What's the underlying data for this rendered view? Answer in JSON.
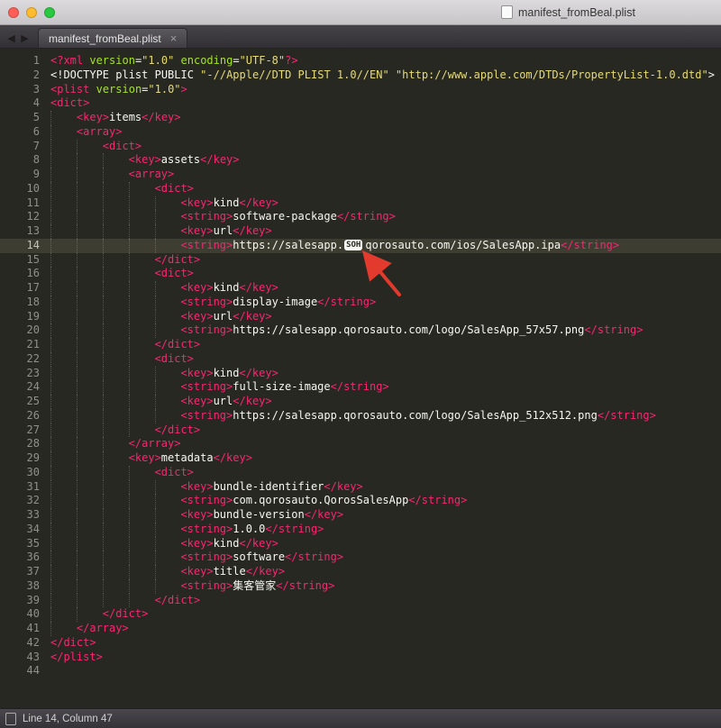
{
  "window": {
    "title": "manifest_fromBeal.plist"
  },
  "tab_bar": {
    "back_icon": "◀",
    "forward_icon": "▶",
    "tabs": [
      {
        "label": "manifest_fromBeal.plist",
        "close_icon": "×",
        "active": true
      }
    ]
  },
  "status_bar": {
    "text": "Line 14, Column 47"
  },
  "colors": {
    "editor_bg": "#272822",
    "text": "#f8f8f2",
    "tag": "#f92672",
    "string": "#e6db74",
    "attribute": "#a6e22e",
    "line_number": "#90908a",
    "current_line_bg": "#3e3d32",
    "control_char_bg": "#f8f8f2",
    "control_char_fg": "#272822",
    "annotation_arrow": "#e23b2e",
    "traffic_close": "#ff5f57",
    "traffic_minimize": "#febc2e",
    "traffic_zoom": "#28c840"
  },
  "editor": {
    "current_line": 14,
    "cursor": {
      "line": 14,
      "column": 47
    },
    "control_char_label": "SOH",
    "lines": [
      {
        "num": 1,
        "ind": 0,
        "segs": [
          [
            "p",
            "<?xml"
          ],
          [
            "w",
            " "
          ],
          [
            "g",
            "version"
          ],
          [
            "w",
            "="
          ],
          [
            "y",
            "\"1.0\""
          ],
          [
            "w",
            " "
          ],
          [
            "g",
            "encoding"
          ],
          [
            "w",
            "="
          ],
          [
            "y",
            "\"UTF-8\""
          ],
          [
            "p",
            "?>"
          ]
        ]
      },
      {
        "num": 2,
        "ind": 0,
        "segs": [
          [
            "w",
            "<!DOCTYPE plist PUBLIC "
          ],
          [
            "y",
            "\"-//Apple//DTD PLIST 1.0//EN\""
          ],
          [
            "w",
            " "
          ],
          [
            "y",
            "\"http://www.apple.com/DTDs/PropertyList-1.0.dtd\""
          ],
          [
            "w",
            ">"
          ]
        ]
      },
      {
        "num": 3,
        "ind": 0,
        "segs": [
          [
            "p",
            "<plist"
          ],
          [
            "w",
            " "
          ],
          [
            "g",
            "version"
          ],
          [
            "w",
            "="
          ],
          [
            "y",
            "\"1.0\""
          ],
          [
            "p",
            ">"
          ]
        ]
      },
      {
        "num": 4,
        "ind": 0,
        "segs": [
          [
            "p",
            "<dict>"
          ]
        ]
      },
      {
        "num": 5,
        "ind": 1,
        "segs": [
          [
            "p",
            "<key>"
          ],
          [
            "w",
            "items"
          ],
          [
            "p",
            "</key>"
          ]
        ]
      },
      {
        "num": 6,
        "ind": 1,
        "segs": [
          [
            "p",
            "<array>"
          ]
        ]
      },
      {
        "num": 7,
        "ind": 2,
        "segs": [
          [
            "p",
            "<dict>"
          ]
        ]
      },
      {
        "num": 8,
        "ind": 3,
        "segs": [
          [
            "p",
            "<key>"
          ],
          [
            "w",
            "assets"
          ],
          [
            "p",
            "</key>"
          ]
        ]
      },
      {
        "num": 9,
        "ind": 3,
        "segs": [
          [
            "p",
            "<array>"
          ]
        ]
      },
      {
        "num": 10,
        "ind": 4,
        "segs": [
          [
            "p",
            "<dict>"
          ]
        ]
      },
      {
        "num": 11,
        "ind": 5,
        "segs": [
          [
            "p",
            "<key>"
          ],
          [
            "w",
            "kind"
          ],
          [
            "p",
            "</key>"
          ]
        ]
      },
      {
        "num": 12,
        "ind": 5,
        "segs": [
          [
            "p",
            "<string>"
          ],
          [
            "w",
            "software-package"
          ],
          [
            "p",
            "</string>"
          ]
        ]
      },
      {
        "num": 13,
        "ind": 5,
        "segs": [
          [
            "p",
            "<key>"
          ],
          [
            "w",
            "url"
          ],
          [
            "p",
            "</key>"
          ]
        ]
      },
      {
        "num": 14,
        "ind": 5,
        "segs": [
          [
            "p",
            "<string>"
          ],
          [
            "w",
            "https://salesapp."
          ],
          [
            "c",
            "SOH"
          ],
          [
            "w",
            "qorosauto.com/ios/SalesApp.ipa"
          ],
          [
            "p",
            "</string>"
          ]
        ]
      },
      {
        "num": 15,
        "ind": 4,
        "segs": [
          [
            "p",
            "</dict>"
          ]
        ]
      },
      {
        "num": 16,
        "ind": 4,
        "segs": [
          [
            "p",
            "<dict>"
          ]
        ]
      },
      {
        "num": 17,
        "ind": 5,
        "segs": [
          [
            "p",
            "<key>"
          ],
          [
            "w",
            "kind"
          ],
          [
            "p",
            "</key>"
          ]
        ]
      },
      {
        "num": 18,
        "ind": 5,
        "segs": [
          [
            "p",
            "<string>"
          ],
          [
            "w",
            "display-image"
          ],
          [
            "p",
            "</string>"
          ]
        ]
      },
      {
        "num": 19,
        "ind": 5,
        "segs": [
          [
            "p",
            "<key>"
          ],
          [
            "w",
            "url"
          ],
          [
            "p",
            "</key>"
          ]
        ]
      },
      {
        "num": 20,
        "ind": 5,
        "segs": [
          [
            "p",
            "<string>"
          ],
          [
            "w",
            "https://salesapp.qorosauto.com/logo/SalesApp_57x57.png"
          ],
          [
            "p",
            "</string>"
          ]
        ]
      },
      {
        "num": 21,
        "ind": 4,
        "segs": [
          [
            "p",
            "</dict>"
          ]
        ]
      },
      {
        "num": 22,
        "ind": 4,
        "segs": [
          [
            "p",
            "<dict>"
          ]
        ]
      },
      {
        "num": 23,
        "ind": 5,
        "segs": [
          [
            "p",
            "<key>"
          ],
          [
            "w",
            "kind"
          ],
          [
            "p",
            "</key>"
          ]
        ]
      },
      {
        "num": 24,
        "ind": 5,
        "segs": [
          [
            "p",
            "<string>"
          ],
          [
            "w",
            "full-size-image"
          ],
          [
            "p",
            "</string>"
          ]
        ]
      },
      {
        "num": 25,
        "ind": 5,
        "segs": [
          [
            "p",
            "<key>"
          ],
          [
            "w",
            "url"
          ],
          [
            "p",
            "</key>"
          ]
        ]
      },
      {
        "num": 26,
        "ind": 5,
        "segs": [
          [
            "p",
            "<string>"
          ],
          [
            "w",
            "https://salesapp.qorosauto.com/logo/SalesApp_512x512.png"
          ],
          [
            "p",
            "</string>"
          ]
        ]
      },
      {
        "num": 27,
        "ind": 4,
        "segs": [
          [
            "p",
            "</dict>"
          ]
        ]
      },
      {
        "num": 28,
        "ind": 3,
        "segs": [
          [
            "p",
            "</array>"
          ]
        ]
      },
      {
        "num": 29,
        "ind": 3,
        "segs": [
          [
            "p",
            "<key>"
          ],
          [
            "w",
            "metadata"
          ],
          [
            "p",
            "</key>"
          ]
        ]
      },
      {
        "num": 30,
        "ind": 4,
        "segs": [
          [
            "p",
            "<dict>"
          ]
        ]
      },
      {
        "num": 31,
        "ind": 5,
        "segs": [
          [
            "p",
            "<key>"
          ],
          [
            "w",
            "bundle-identifier"
          ],
          [
            "p",
            "</key>"
          ]
        ]
      },
      {
        "num": 32,
        "ind": 5,
        "segs": [
          [
            "p",
            "<string>"
          ],
          [
            "w",
            "com.qorosauto.QorosSalesApp"
          ],
          [
            "p",
            "</string>"
          ]
        ]
      },
      {
        "num": 33,
        "ind": 5,
        "segs": [
          [
            "p",
            "<key>"
          ],
          [
            "w",
            "bundle-version"
          ],
          [
            "p",
            "</key>"
          ]
        ]
      },
      {
        "num": 34,
        "ind": 5,
        "segs": [
          [
            "p",
            "<string>"
          ],
          [
            "w",
            "1.0.0"
          ],
          [
            "p",
            "</string>"
          ]
        ]
      },
      {
        "num": 35,
        "ind": 5,
        "segs": [
          [
            "p",
            "<key>"
          ],
          [
            "w",
            "kind"
          ],
          [
            "p",
            "</key>"
          ]
        ]
      },
      {
        "num": 36,
        "ind": 5,
        "segs": [
          [
            "p",
            "<string>"
          ],
          [
            "w",
            "software"
          ],
          [
            "p",
            "</string>"
          ]
        ]
      },
      {
        "num": 37,
        "ind": 5,
        "segs": [
          [
            "p",
            "<key>"
          ],
          [
            "w",
            "title"
          ],
          [
            "p",
            "</key>"
          ]
        ]
      },
      {
        "num": 38,
        "ind": 5,
        "segs": [
          [
            "p",
            "<string>"
          ],
          [
            "w",
            "集客管家"
          ],
          [
            "p",
            "</string>"
          ]
        ]
      },
      {
        "num": 39,
        "ind": 4,
        "segs": [
          [
            "p",
            "</dict>"
          ]
        ]
      },
      {
        "num": 40,
        "ind": 2,
        "segs": [
          [
            "p",
            "</dict>"
          ]
        ]
      },
      {
        "num": 41,
        "ind": 1,
        "segs": [
          [
            "p",
            "</array>"
          ]
        ]
      },
      {
        "num": 42,
        "ind": 0,
        "segs": [
          [
            "p",
            "</dict>"
          ]
        ]
      },
      {
        "num": 43,
        "ind": 0,
        "segs": [
          [
            "p",
            "</plist>"
          ]
        ]
      },
      {
        "num": 44,
        "ind": 0,
        "segs": []
      }
    ]
  }
}
